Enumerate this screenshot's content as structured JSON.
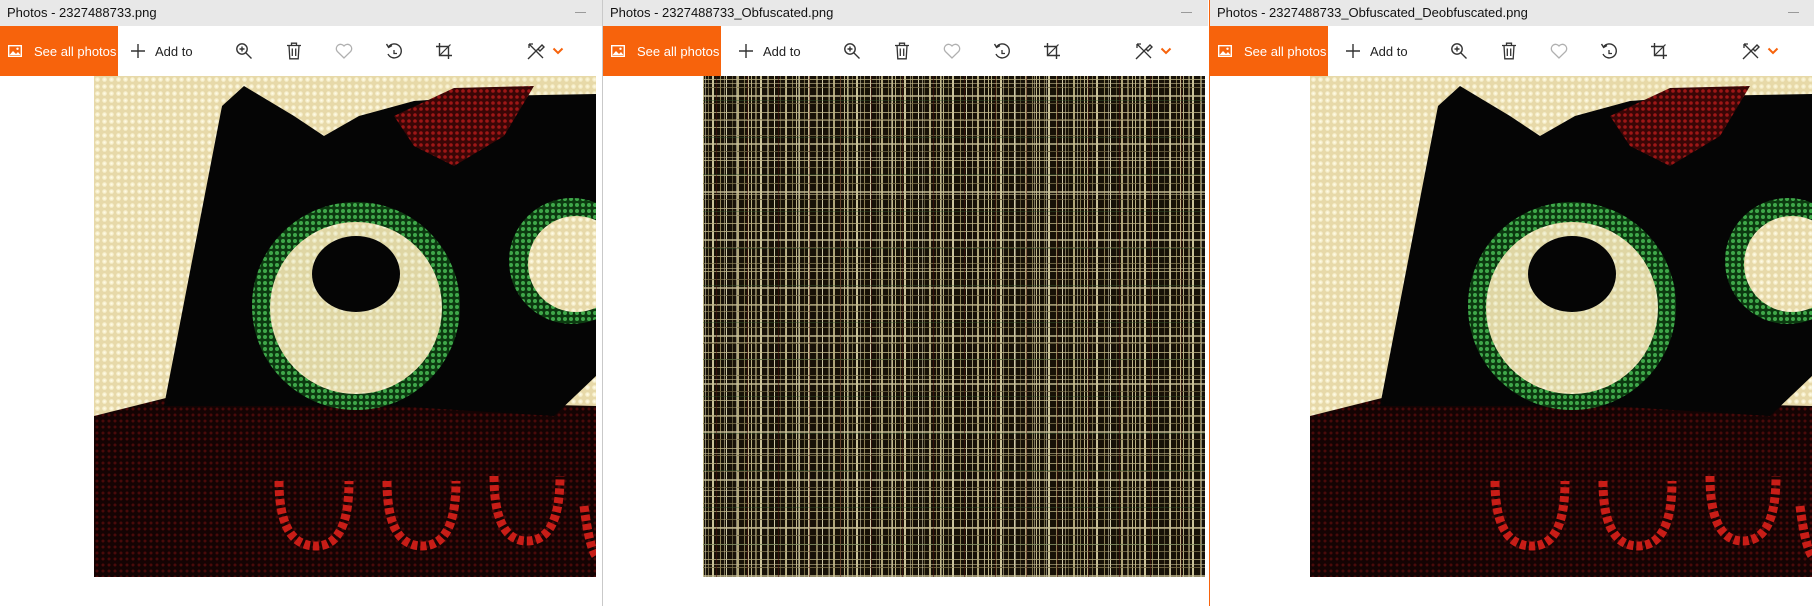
{
  "colors": {
    "accent": "#f7630c",
    "titlebar_bg": "#e8e8e8",
    "icon": "#3a3a3a",
    "separator_left": "#c9c9c9",
    "separator_right": "#f7630c"
  },
  "windows": [
    {
      "title": "Photos - 2327488733.png",
      "toolbar": {
        "see_all_label": "See all photos",
        "add_to_label": "Add to",
        "icons": [
          "zoom-in-icon",
          "delete-icon",
          "favorite-icon",
          "rotate-icon",
          "crop-icon",
          "edit-draw-icon",
          "chevron-down-icon"
        ]
      },
      "image_description": "Original photo of knitted owl face"
    },
    {
      "title": "Photos - 2327488733_Obfuscated.png",
      "toolbar": {
        "see_all_label": "See all photos",
        "add_to_label": "Add to",
        "icons": [
          "zoom-in-icon",
          "delete-icon",
          "favorite-icon",
          "rotate-icon",
          "crop-icon",
          "edit-draw-icon",
          "chevron-down-icon"
        ]
      },
      "image_description": "Scrambled noise image"
    },
    {
      "title": "Photos - 2327488733_Obfuscated_Deobfuscated.png",
      "toolbar": {
        "see_all_label": "See all photos",
        "add_to_label": "Add to",
        "icons": [
          "zoom-in-icon",
          "delete-icon",
          "favorite-icon",
          "rotate-icon",
          "crop-icon",
          "edit-draw-icon",
          "chevron-down-icon"
        ]
      },
      "image_description": "Restored photo of knitted owl face"
    }
  ]
}
